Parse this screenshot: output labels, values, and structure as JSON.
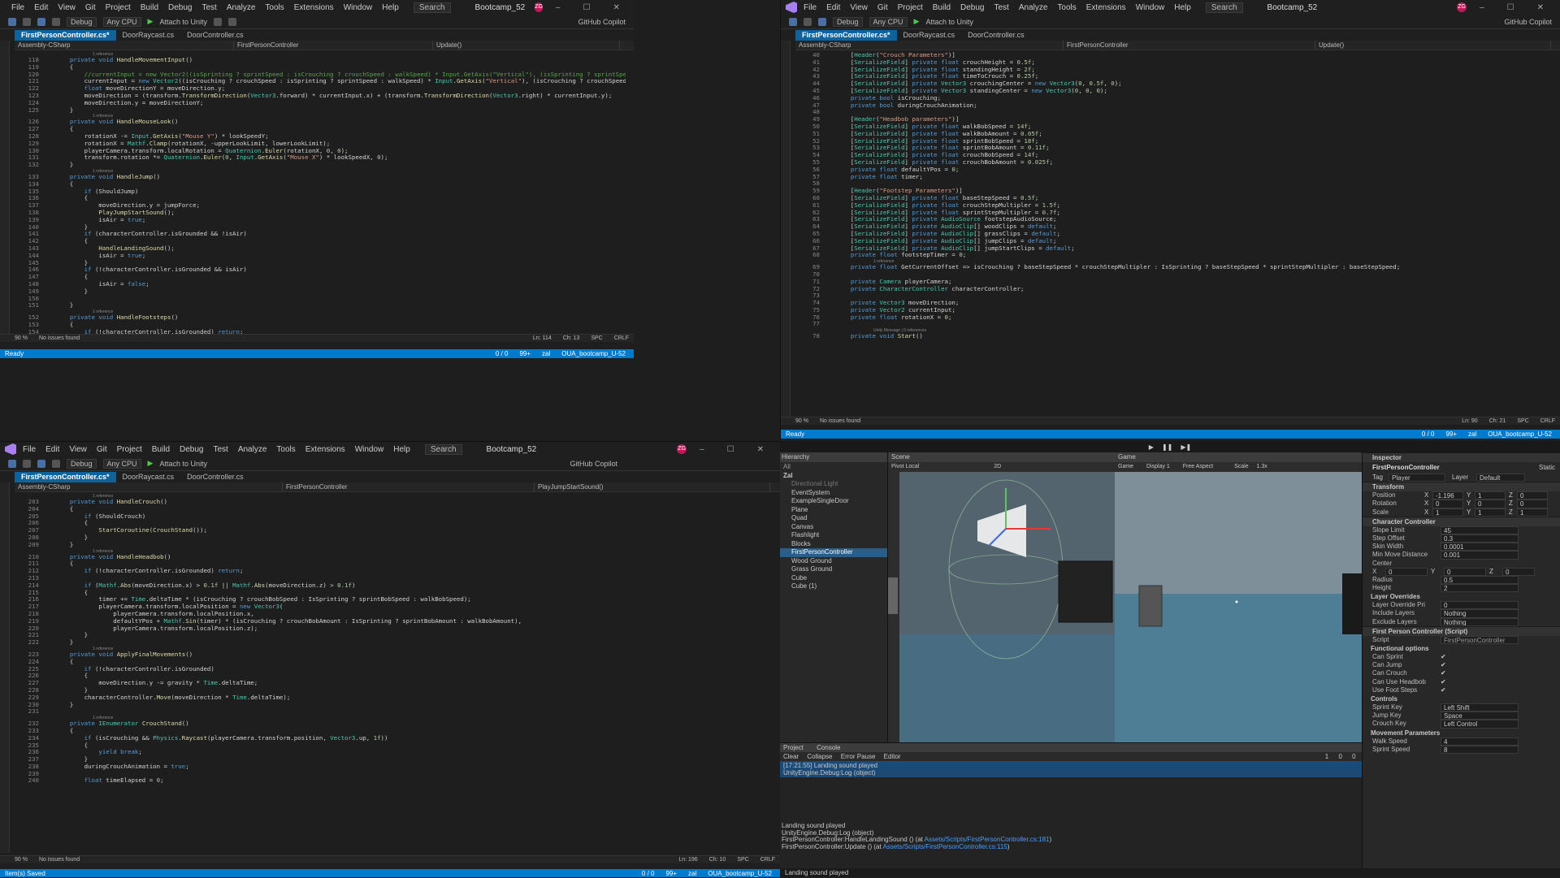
{
  "menu": {
    "items": [
      "File",
      "Edit",
      "View",
      "Git",
      "Project",
      "Build",
      "Debug",
      "Test",
      "Analyze",
      "Tools",
      "Extensions",
      "Window",
      "Help"
    ],
    "search": "Search",
    "solution": "Bootcamp_52",
    "avatar": "ZG"
  },
  "toolbar": {
    "config": "Debug",
    "platform": "Any CPU",
    "attach": "Attach to Unity",
    "copilot": "GitHub Copilot"
  },
  "tabs": [
    "FirstPersonController.cs*",
    "DoorRaycast.cs",
    "DoorController.cs"
  ],
  "navbar": {
    "assembly": "Assembly-CSharp",
    "class": "FirstPersonController",
    "method_tl": "Update()",
    "method_bl": "PlayJumpStartSound()"
  },
  "editor_tl": {
    "lines": [
      {
        "n": "",
        "c": "1 reference",
        "h": true
      },
      {
        "n": "118",
        "c": "    private void HandleMovementInput()"
      },
      {
        "n": "119",
        "c": "    {"
      },
      {
        "n": "120",
        "c": "        //currentInput = new Vector2((isSprinting ? sprintSpeed : isCrouching ? crouchSpeed : walkSpeed) * Input.GetAxis(\"Vertical\"), (isSprinting ? sprintSpeed : isCrouching"
      },
      {
        "n": "121",
        "c": "        currentInput = new Vector2((isCrouching ? crouchSpeed : isSprinting ? sprintSpeed : walkSpeed) * Input.GetAxis(\"Vertical\"), (isCrouching ? crouchSpeed : isSprinting ? sprintSpeed : walkS"
      },
      {
        "n": "122",
        "c": "        float moveDirectionY = moveDirection.y;"
      },
      {
        "n": "123",
        "c": "        moveDirection = (transform.TransformDirection(Vector3.forward) * currentInput.x) + (transform.TransformDirection(Vector3.right) * currentInput.y);"
      },
      {
        "n": "124",
        "c": "        moveDirection.y = moveDirectionY;"
      },
      {
        "n": "125",
        "c": "    }"
      },
      {
        "n": "",
        "c": "1 reference",
        "h": true
      },
      {
        "n": "126",
        "c": "    private void HandleMouseLook()"
      },
      {
        "n": "127",
        "c": "    {"
      },
      {
        "n": "128",
        "c": "        rotationX -= Input.GetAxis(\"Mouse Y\") * lookSpeedY;"
      },
      {
        "n": "129",
        "c": "        rotationX = Mathf.Clamp(rotationX, -upperLookLimit, lowerLookLimit);"
      },
      {
        "n": "130",
        "c": "        playerCamera.transform.localRotation = Quaternion.Euler(rotationX, 0, 0);"
      },
      {
        "n": "131",
        "c": "        transform.rotation *= Quaternion.Euler(0, Input.GetAxis(\"Mouse X\") * lookSpeedX, 0);"
      },
      {
        "n": "132",
        "c": "    }"
      },
      {
        "n": "",
        "c": "1 reference",
        "h": true
      },
      {
        "n": "133",
        "c": "    private void HandleJump()"
      },
      {
        "n": "134",
        "c": "    {"
      },
      {
        "n": "135",
        "c": "        if (ShouldJump)"
      },
      {
        "n": "136",
        "c": "        {"
      },
      {
        "n": "137",
        "c": "            moveDirection.y = jumpForce;"
      },
      {
        "n": "138",
        "c": "            PlayJumpStartSound();"
      },
      {
        "n": "139",
        "c": "            isAir = true;"
      },
      {
        "n": "140",
        "c": "        }"
      },
      {
        "n": "141",
        "c": "        if (characterController.isGrounded && !isAir)"
      },
      {
        "n": "142",
        "c": "        {"
      },
      {
        "n": "143",
        "c": "            HandleLandingSound();"
      },
      {
        "n": "144",
        "c": "            isAir = true;"
      },
      {
        "n": "145",
        "c": "        }"
      },
      {
        "n": "146",
        "c": "        if (!characterController.isGrounded && isAir)"
      },
      {
        "n": "147",
        "c": "        {"
      },
      {
        "n": "148",
        "c": "            isAir = false;"
      },
      {
        "n": "149",
        "c": "        }"
      },
      {
        "n": "150",
        "c": ""
      },
      {
        "n": "151",
        "c": "    }"
      },
      {
        "n": "",
        "c": "1 reference",
        "h": true
      },
      {
        "n": "152",
        "c": "    private void HandleFootsteps()"
      },
      {
        "n": "153",
        "c": "    {"
      },
      {
        "n": "154",
        "c": "        if (!characterController.isGrounded) return;"
      },
      {
        "n": "155",
        "c": "        if (currentInput == Vector2.zero) return;"
      }
    ],
    "zoom": "90 %",
    "issues": "No issues found",
    "pos": "Ln: 114",
    "col": "Ch: 13",
    "spc": "SPC",
    "crlf": "CRLF"
  },
  "editor_tr": {
    "lines": [
      {
        "n": "40",
        "c": "    [Header(\"Crouch Parameters\")]"
      },
      {
        "n": "41",
        "c": "    [SerializeField] private float crouchHeight = 0.5f;"
      },
      {
        "n": "42",
        "c": "    [SerializeField] private float standingHeight = 2f;"
      },
      {
        "n": "43",
        "c": "    [SerializeField] private float timeToCrouch = 0.25f;"
      },
      {
        "n": "44",
        "c": "    [SerializeField] private Vector3 crouchingCenter = new Vector3(0, 0.5f, 0);"
      },
      {
        "n": "45",
        "c": "    [SerializeField] private Vector3 standingCenter = new Vector3(0, 0, 0);"
      },
      {
        "n": "46",
        "c": "    private bool isCrouching;"
      },
      {
        "n": "47",
        "c": "    private bool duringCrouchAnimation;"
      },
      {
        "n": "48",
        "c": ""
      },
      {
        "n": "49",
        "c": "    [Header(\"Headbob parameters\")]"
      },
      {
        "n": "50",
        "c": "    [SerializeField] private float walkBobSpeed = 14f;"
      },
      {
        "n": "51",
        "c": "    [SerializeField] private float walkBobAmount = 0.05f;"
      },
      {
        "n": "52",
        "c": "    [SerializeField] private float sprintBobSpeed = 18f;"
      },
      {
        "n": "53",
        "c": "    [SerializeField] private float sprintBobAmount = 0.11f;"
      },
      {
        "n": "54",
        "c": "    [SerializeField] private float crouchBobSpeed = 14f;"
      },
      {
        "n": "55",
        "c": "    [SerializeField] private float crouchBobAmount = 0.025f;"
      },
      {
        "n": "56",
        "c": "    private float defaultYPos = 0;"
      },
      {
        "n": "57",
        "c": "    private float timer;"
      },
      {
        "n": "58",
        "c": ""
      },
      {
        "n": "59",
        "c": "    [Header(\"Footstep Parameters\")]"
      },
      {
        "n": "60",
        "c": "    [SerializeField] private float baseStepSpeed = 0.5f;"
      },
      {
        "n": "61",
        "c": "    [SerializeField] private float crouchStepMultipler = 1.5f;"
      },
      {
        "n": "62",
        "c": "    [SerializeField] private float sprintStepMultipler = 0.7f;"
      },
      {
        "n": "63",
        "c": "    [SerializeField] private AudioSource footstepAudioSource;"
      },
      {
        "n": "64",
        "c": "    [SerializeField] private AudioClip[] woodClips = default;"
      },
      {
        "n": "65",
        "c": "    [SerializeField] private AudioClip[] grassClips = default;"
      },
      {
        "n": "66",
        "c": "    [SerializeField] private AudioClip[] jumpClips = default;"
      },
      {
        "n": "67",
        "c": "    [SerializeField] private AudioClip[] jumpStartClips = default;"
      },
      {
        "n": "68",
        "c": "    private float footstepTimer = 0;"
      },
      {
        "n": "",
        "c": "1 reference",
        "h": true
      },
      {
        "n": "69",
        "c": "    private float GetCurrentOffset => isCrouching ? baseStepSpeed * crouchStepMultipler : IsSprinting ? baseStepSpeed * sprintStepMultipler : baseStepSpeed;"
      },
      {
        "n": "70",
        "c": ""
      },
      {
        "n": "71",
        "c": "    private Camera playerCamera;"
      },
      {
        "n": "72",
        "c": "    private CharacterController characterController;"
      },
      {
        "n": "73",
        "c": ""
      },
      {
        "n": "74",
        "c": "    private Vector3 moveDirection;"
      },
      {
        "n": "75",
        "c": "    private Vector2 currentInput;"
      },
      {
        "n": "76",
        "c": "    private float rotationX = 0;"
      },
      {
        "n": "77",
        "c": ""
      },
      {
        "n": "",
        "c": "Unity Message | 0 references",
        "h": true
      },
      {
        "n": "78",
        "c": "    private void Start()"
      }
    ],
    "zoom": "90 %",
    "issues": "No issues found",
    "pos": "Ln: 90",
    "col": "Ch: 21",
    "spc": "SPC",
    "crlf": "CRLF"
  },
  "editor_bl": {
    "lines": [
      {
        "n": "",
        "c": "1 reference",
        "h": true
      },
      {
        "n": "203",
        "c": "    private void HandleCrouch()"
      },
      {
        "n": "204",
        "c": "    {"
      },
      {
        "n": "205",
        "c": "        if (ShouldCrouch)"
      },
      {
        "n": "206",
        "c": "        {"
      },
      {
        "n": "207",
        "c": "            StartCoroutine(CrouchStand());"
      },
      {
        "n": "208",
        "c": "        }"
      },
      {
        "n": "209",
        "c": "    }"
      },
      {
        "n": "",
        "c": "1 reference",
        "h": true
      },
      {
        "n": "210",
        "c": "    private void HandleHeadbob()"
      },
      {
        "n": "211",
        "c": "    {"
      },
      {
        "n": "212",
        "c": "        if (!characterController.isGrounded) return;"
      },
      {
        "n": "213",
        "c": ""
      },
      {
        "n": "214",
        "c": "        if (Mathf.Abs(moveDirection.x) > 0.1f || Mathf.Abs(moveDirection.z) > 0.1f)"
      },
      {
        "n": "215",
        "c": "        {"
      },
      {
        "n": "216",
        "c": "            timer += Time.deltaTime * (isCrouching ? crouchBobSpeed : IsSprinting ? sprintBobSpeed : walkBobSpeed);"
      },
      {
        "n": "217",
        "c": "            playerCamera.transform.localPosition = new Vector3("
      },
      {
        "n": "218",
        "c": "                playerCamera.transform.localPosition.x,"
      },
      {
        "n": "219",
        "c": "                defaultYPos + Mathf.Sin(timer) * (isCrouching ? crouchBobAmount : IsSprinting ? sprintBobAmount : walkBobAmount),"
      },
      {
        "n": "220",
        "c": "                playerCamera.transform.localPosition.z);"
      },
      {
        "n": "221",
        "c": "        }"
      },
      {
        "n": "222",
        "c": "    }"
      },
      {
        "n": "",
        "c": "1 reference",
        "h": true
      },
      {
        "n": "223",
        "c": "    private void ApplyFinalMovements()"
      },
      {
        "n": "224",
        "c": "    {"
      },
      {
        "n": "225",
        "c": "        if (!characterController.isGrounded)"
      },
      {
        "n": "226",
        "c": "        {"
      },
      {
        "n": "227",
        "c": "            moveDirection.y -= gravity * Time.deltaTime;"
      },
      {
        "n": "228",
        "c": "        }"
      },
      {
        "n": "229",
        "c": "        characterController.Move(moveDirection * Time.deltaTime);"
      },
      {
        "n": "230",
        "c": "    }"
      },
      {
        "n": "231",
        "c": ""
      },
      {
        "n": "",
        "c": "1 reference",
        "h": true
      },
      {
        "n": "232",
        "c": "    private IEnumerator CrouchStand()"
      },
      {
        "n": "233",
        "c": "    {"
      },
      {
        "n": "234",
        "c": "        if (isCrouching && Physics.Raycast(playerCamera.transform.position, Vector3.up, 1f))"
      },
      {
        "n": "235",
        "c": "        {"
      },
      {
        "n": "236",
        "c": "            yield break;"
      },
      {
        "n": "237",
        "c": "        }"
      },
      {
        "n": "238",
        "c": "        duringCrouchAnimation = true;"
      },
      {
        "n": "239",
        "c": ""
      },
      {
        "n": "240",
        "c": "        float timeElapsed = 0;"
      }
    ],
    "zoom": "90 %",
    "issues": "No issues found",
    "pos": "Ln: 196",
    "col": "Ch: 10",
    "spc": "SPC",
    "crlf": "CRLF"
  },
  "status": {
    "ready": "Ready",
    "saved": "Item(s) Saved",
    "changes": "0 / 0",
    "edits": "99+",
    "branch": "zal",
    "repo": "OUA_bootcamp_U-52"
  },
  "unity": {
    "hierarchy_title": "Hierarchy",
    "search_placeholder": "All",
    "root": "Zal",
    "items": [
      "Directional Light",
      "EventSystem",
      "ExampleSingleDoor",
      "Plane",
      "Quad",
      "Canvas",
      "Flashlight",
      "Blocks",
      "FirstPersonController",
      "Wood Ground",
      "Grass Ground",
      "Cube",
      "Cube (1)"
    ],
    "selected_index": 8,
    "scene_tab": "Scene",
    "scene_tools": "Pivot   Local",
    "scene_2d": "2D",
    "game_tab": "Game",
    "game_tools": [
      "Game",
      "Display 1",
      "Free Aspect",
      "Scale",
      "1.3x"
    ],
    "console_tabs": [
      "Project",
      "Console"
    ],
    "console_tools": [
      "Clear",
      "Collapse",
      "Error Pause",
      "Editor"
    ],
    "console_counts": [
      "1",
      "0",
      "0"
    ],
    "console_msg": "[17:21:55] Landing sound played\nUnityEngine.Debug:Log (object)",
    "console_detail_1": "Landing sound played\nUnityEngine.Debug:Log (object)\nFirstPersonController:HandleLandingSound () (at ",
    "console_path_1": "Assets/Scripts/FirstPersonController.cs:181",
    "console_detail_2": ")\nFirstPersonController:Update () (at ",
    "console_path_2": "Assets/Scripts/FirstPersonController.cs:115",
    "console_detail_3": ")",
    "bottom_status": "Landing sound played",
    "inspector": {
      "title": "Inspector",
      "object": "FirstPersonController",
      "static": "Static",
      "tag_label": "Tag",
      "tag": "Player",
      "layer_label": "Layer",
      "layer": "Default",
      "transform": "Transform",
      "position": [
        "Position",
        "X",
        "-1.196",
        "Y",
        "1",
        "Z",
        "0"
      ],
      "rotation": [
        "Rotation",
        "X",
        "0",
        "Y",
        "0",
        "Z",
        "0"
      ],
      "scale": [
        "Scale",
        "X",
        "1",
        "Y",
        "1",
        "Z",
        "1"
      ],
      "cc": "Character Controller",
      "cc_fields": [
        [
          "Slope Limit",
          "45"
        ],
        [
          "Step Offset",
          "0.3"
        ],
        [
          "Skin Width",
          "0.0001"
        ],
        [
          "Min Move Distance",
          "0.001"
        ],
        [
          "Center",
          ""
        ]
      ],
      "center": [
        "X",
        "0",
        "Y",
        "0",
        "Z",
        "0"
      ],
      "cc_fields2": [
        [
          "Radius",
          "0.5"
        ],
        [
          "Height",
          "2"
        ]
      ],
      "layer_overrides": "Layer Overrides",
      "lo_fields": [
        [
          "Layer Override Pri",
          "0"
        ],
        [
          "Include Layers",
          "Nothing"
        ],
        [
          "Exclude Layers",
          "Nothing"
        ]
      ],
      "script_comp": "First Person Controller (Script)",
      "script_label": "Script",
      "script_value": "FirstPersonController",
      "func_opts": "Functional options",
      "checks": [
        "Can Sprint",
        "Can Jump",
        "Can Crouch",
        "Can Use Headbob",
        "Use Foot Steps"
      ],
      "controls": "Controls",
      "keys": [
        [
          "Sprint Key",
          "Left Shift"
        ],
        [
          "Jump Key",
          "Space"
        ],
        [
          "Crouch Key",
          "Left Control"
        ]
      ],
      "movement": "Movement Parameters",
      "move_fields": [
        [
          "Walk Speed",
          "4"
        ],
        [
          "Sprint Speed",
          "8"
        ]
      ]
    }
  }
}
